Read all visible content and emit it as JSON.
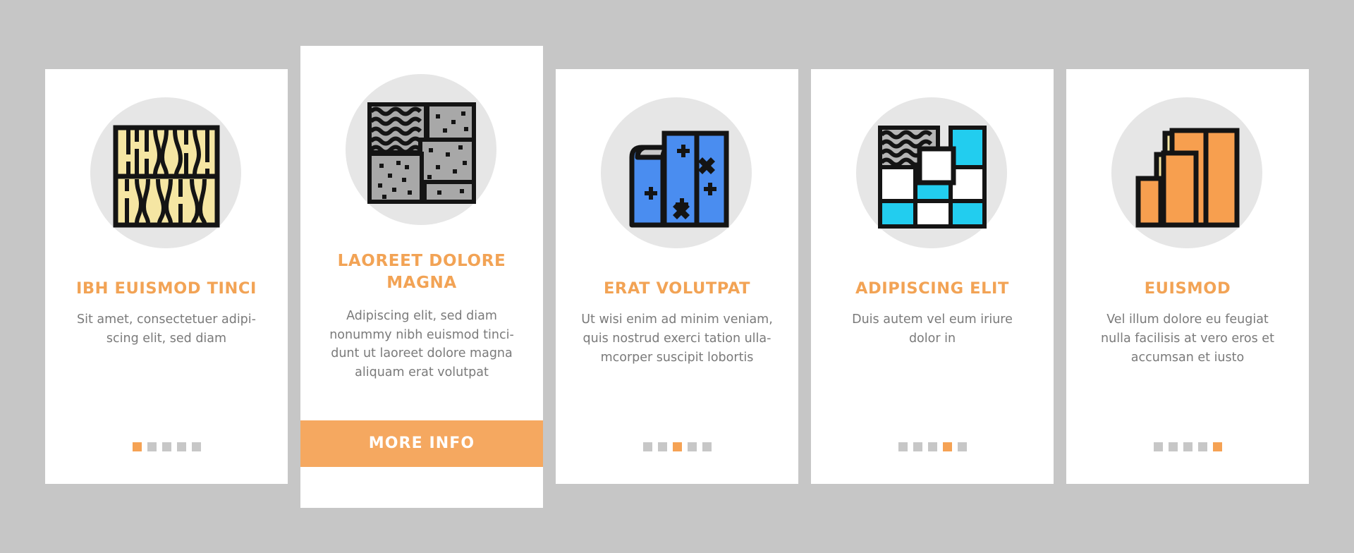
{
  "page": {
    "background_color": "#c6c6c6",
    "card_background": "#ffffff",
    "accent_color": "#f2a355",
    "muted_text_color": "#7a7a7a",
    "dot_inactive_color": "#c7c7c7",
    "icon_blob_color": "#e6e6e6"
  },
  "cards": [
    {
      "icon": "wood-plank-texture-icon",
      "icon_colors": {
        "fill": "#f5e6a3",
        "stroke": "#141414"
      },
      "title": "IBH EUISMOD TINCI",
      "description": "Sit amet, consectetuer adipi-scing elit, sed diam",
      "dots": {
        "count": 5,
        "active_index": 0
      },
      "featured": false,
      "button_label": null
    },
    {
      "icon": "stone-tile-texture-icon",
      "icon_colors": {
        "fill": "#a8a8a8",
        "stroke": "#141414"
      },
      "title": "LAOREET DOLORE MAGNA",
      "description": "Adipiscing elit, sed diam nonummy nibh euismod tinci-dunt ut laoreet dolore magna aliquam erat volutpat",
      "dots": null,
      "featured": true,
      "button_label": "MORE INFO"
    },
    {
      "icon": "carpet-roll-icon",
      "icon_colors": {
        "fill": "#4a8df0",
        "stroke": "#141414"
      },
      "title": "ERAT VOLUTPAT",
      "description": "Ut wisi enim ad minim veniam, quis nostrud exerci tation ulla-mcorper suscipit lobortis",
      "dots": {
        "count": 5,
        "active_index": 2
      },
      "featured": false,
      "button_label": null
    },
    {
      "icon": "mosaic-tile-icon",
      "icon_colors": {
        "fill": "#22cdef",
        "stroke": "#141414"
      },
      "title": "ADIPISCING ELIT",
      "description": "Duis autem vel eum iriure dolor in",
      "dots": {
        "count": 5,
        "active_index": 3
      },
      "featured": false,
      "button_label": null
    },
    {
      "icon": "laminate-planks-icon",
      "icon_colors": {
        "fill": "#f79f4f",
        "stroke": "#141414"
      },
      "title": "EUISMOD",
      "description": "Vel illum dolore eu feugiat nulla facilisis at vero eros et accumsan et iusto",
      "dots": {
        "count": 5,
        "active_index": 4
      },
      "featured": false,
      "button_label": null
    }
  ]
}
